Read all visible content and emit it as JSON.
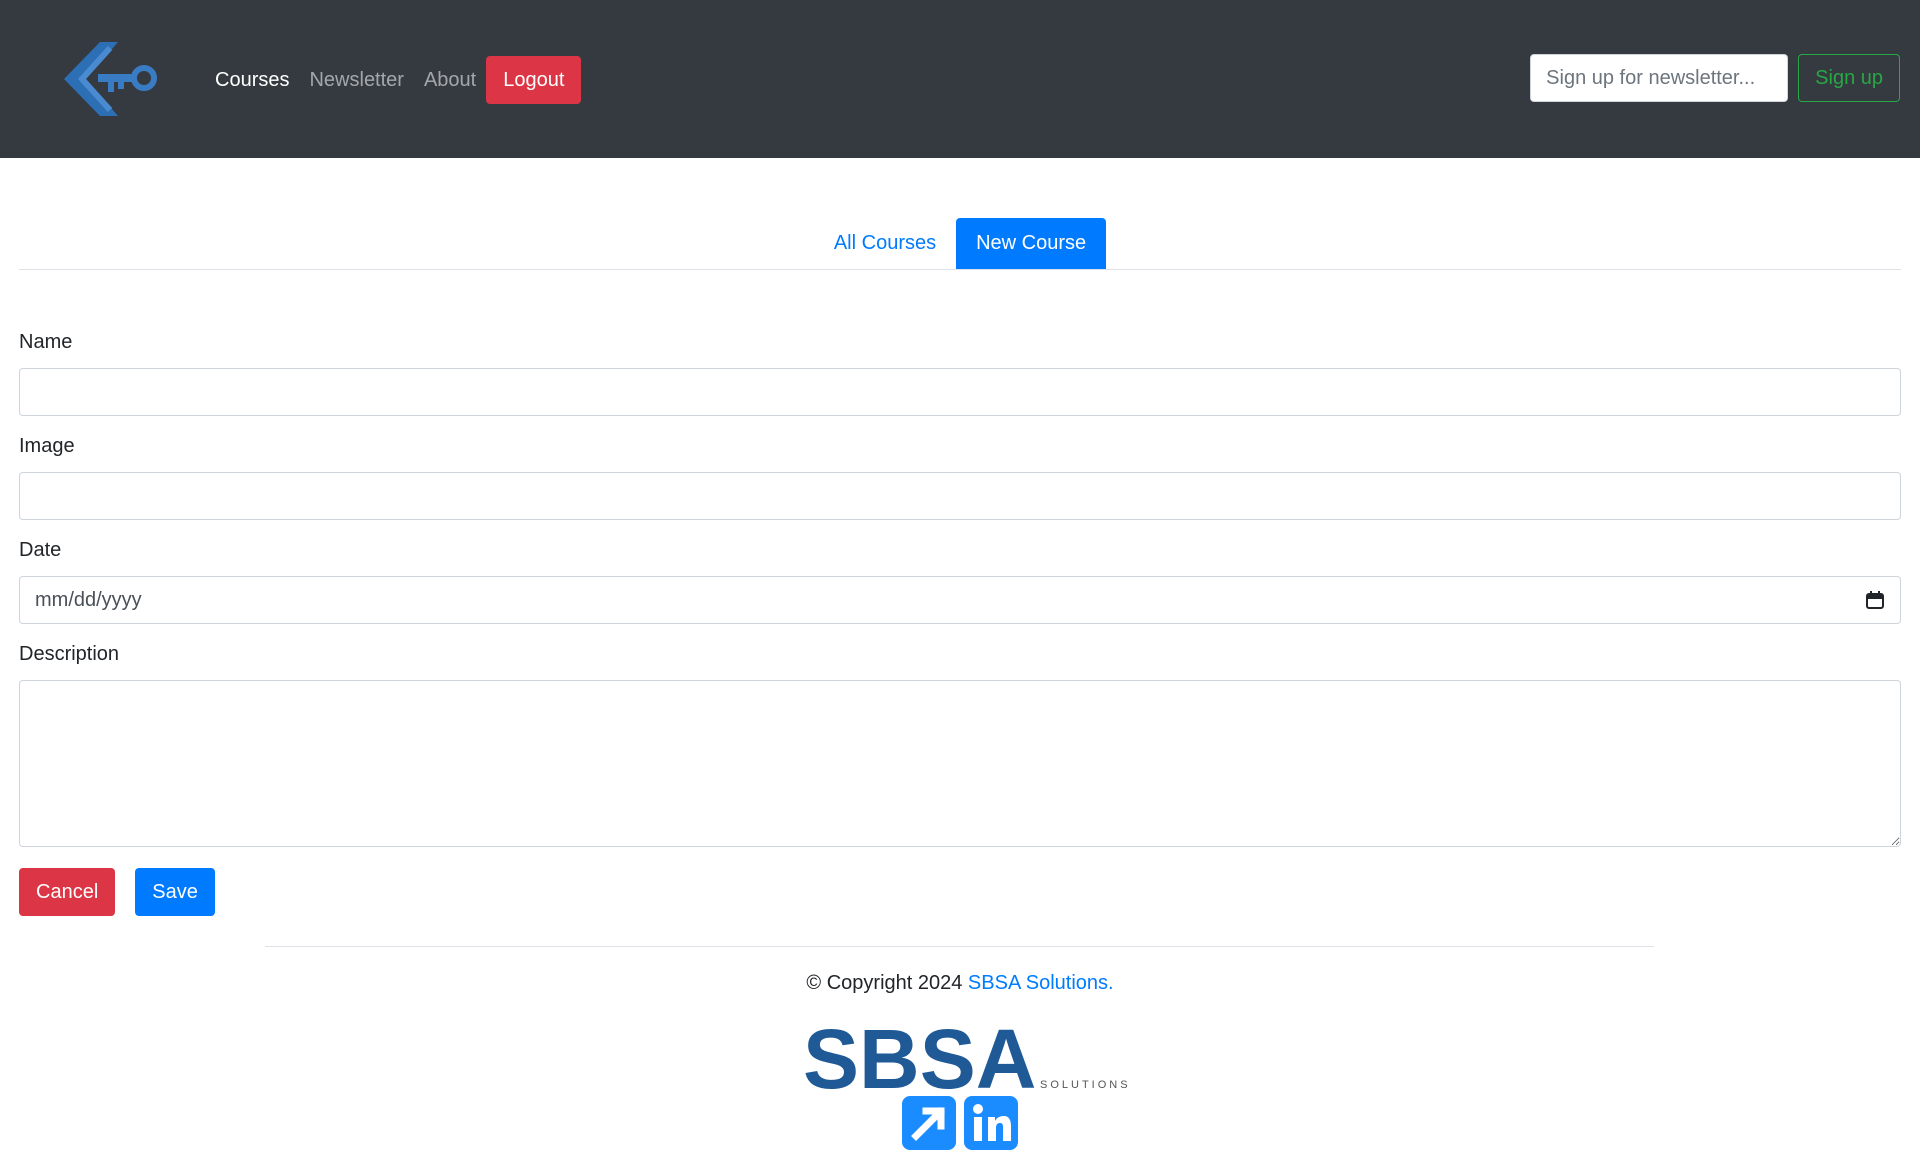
{
  "nav": {
    "links": [
      "Courses",
      "Newsletter",
      "About"
    ],
    "logout_label": "Logout",
    "newsletter_placeholder": "Sign up for newsletter...",
    "signup_label": "Sign up"
  },
  "tabs": [
    "All Courses",
    "New Course"
  ],
  "form": {
    "name_label": "Name",
    "image_label": "Image",
    "date_label": "Date",
    "date_placeholder": "mm/dd/yyyy",
    "description_label": "Description",
    "cancel_label": "Cancel",
    "save_label": "Save"
  },
  "footer": {
    "copyright_text": "© Copyright 2024 ",
    "company_link": "SBSA Solutions.",
    "logo_text": "SBSA",
    "logo_subtext": "SOLUTIONS"
  },
  "colors": {
    "navbar": "#343a40",
    "primary": "#007bff",
    "danger": "#dc3545",
    "success": "#28a745",
    "brand_blue": "#1f5a96"
  },
  "icons": [
    "brand-key-logo-icon",
    "calendar-icon",
    "external-link-icon",
    "linkedin-icon"
  ]
}
